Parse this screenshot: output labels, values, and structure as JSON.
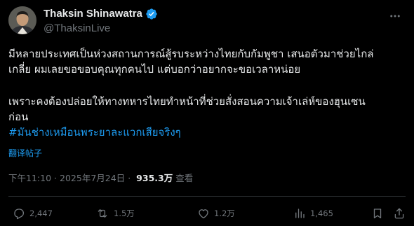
{
  "author": {
    "display_name": "Thaksin Shinawatra",
    "handle": "@ThaksinLive",
    "verified": true
  },
  "post": {
    "paragraph1_line1": "มีหลายประเทศเป็นห่วงสถานการณ์สู้รบระหว่างไทยกับกัมพูชา เสนอตัวมาช่วยไกล่",
    "paragraph1_line2": "เกลี่ย ผมเลยขอขอบคุณทุกคนไป แต่บอกว่าอยากจะขอเวลาหน่อย",
    "paragraph2_line1": "เพราะคงต้องปล่อยให้ทางทหารไทยทำหน้าที่ช่วยสั่งสอนความเจ้าเล่ห์ของฮุนเซน",
    "paragraph2_line2": "ก่อน",
    "hashtag": "#มันช่างเหมือนพระยาละแวกเสียจริงๆ",
    "translate_label": "翻译帖子"
  },
  "meta": {
    "time": "下午11:10",
    "separator": "·",
    "date": "2025年7月24日",
    "views_count": "935.3万",
    "views_label": "查看"
  },
  "actions": {
    "replies": "2,447",
    "reposts": "1.5万",
    "likes": "1.2万",
    "views": "1,465"
  },
  "colors": {
    "background": "#000000",
    "text": "#e7e9ea",
    "muted": "#71767b",
    "accent": "#1d9bf0",
    "divider": "#2f3336"
  },
  "icons": {
    "verified": "verified-badge-icon",
    "more": "more-options-icon",
    "reply": "reply-icon",
    "repost": "repost-icon",
    "like": "like-icon",
    "views": "views-icon",
    "bookmark": "bookmark-icon",
    "share": "share-icon"
  }
}
